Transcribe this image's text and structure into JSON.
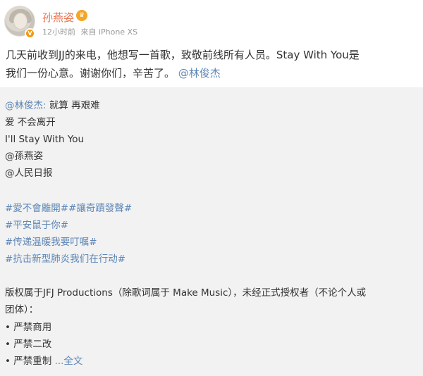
{
  "header": {
    "username": "孙燕姿",
    "time": "12小时前",
    "source": "来自 iPhone XS"
  },
  "post": {
    "text_line1": "几天前收到JJ的来电，他想写一首歌，致敬前线所有人员。Stay With You是",
    "text_line2": "我们一份心意。谢谢你们，辛苦了。",
    "mention": "@林俊杰"
  },
  "repost": {
    "author_mention": "@林俊杰:",
    "lines": [
      "就算 再艰难",
      "爱 不会离开",
      "I'll Stay With You"
    ],
    "mentions": [
      "@孫燕姿",
      "@人民日报"
    ],
    "hashtags": [
      "#愛不會離開##讓奇蹟發聲#",
      "#平安鼠于你#",
      "#传递温暖我要叮嘱#",
      "#抗击新型肺炎我们在行动#"
    ],
    "copyright_line1": "版权属于JFJ Productions（除歌词属于 Make Music），未经正式授权者（不论个人或",
    "copyright_line2": "团体）：",
    "bullets": [
      "• 严禁商用",
      "• 严禁二改",
      "• 严禁重制"
    ],
    "more": "...全文"
  },
  "icons": {
    "verified": "verified-badge-icon",
    "member": "member-crown-icon"
  },
  "colors": {
    "username": "#eb7350",
    "link": "#5d86b5",
    "repost_bg": "#f2f2f2",
    "meta": "#999999"
  }
}
